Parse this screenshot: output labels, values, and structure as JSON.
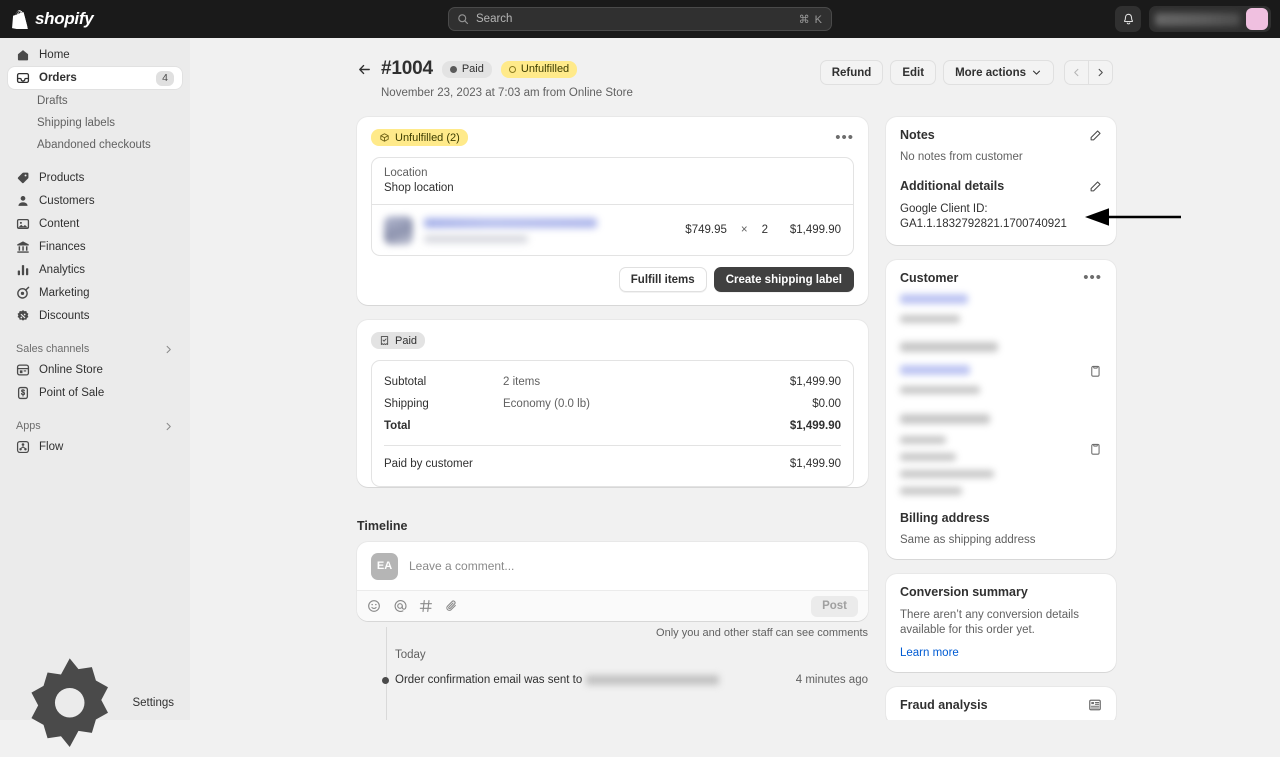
{
  "topbar": {
    "brand": "shopify",
    "brand_icon": "shopify-bag-icon",
    "search_placeholder": "Search",
    "search_shortcut": "⌘ K",
    "notifications_icon": "bell-icon",
    "store_avatar_initials": "",
    "store_name": ""
  },
  "sidebar": {
    "items": [
      {
        "label": "Home",
        "icon": "home-icon",
        "badge": ""
      },
      {
        "label": "Orders",
        "icon": "orders-inbox-icon",
        "badge": "4"
      }
    ],
    "sub_items": [
      {
        "label": "Drafts"
      },
      {
        "label": "Shipping labels"
      },
      {
        "label": "Abandoned checkouts"
      }
    ],
    "items2": [
      {
        "label": "Products",
        "icon": "tag-icon"
      },
      {
        "label": "Customers",
        "icon": "person-icon"
      },
      {
        "label": "Content",
        "icon": "content-icon"
      },
      {
        "label": "Finances",
        "icon": "bank-icon"
      },
      {
        "label": "Analytics",
        "icon": "bar-chart-icon"
      },
      {
        "label": "Marketing",
        "icon": "megaphone-target-icon"
      },
      {
        "label": "Discounts",
        "icon": "discount-badge-icon"
      }
    ],
    "section_sales": "Sales channels",
    "sales_channels": [
      {
        "label": "Online Store",
        "icon": "storefront-icon"
      },
      {
        "label": "Point of Sale",
        "icon": "pos-icon"
      }
    ],
    "section_apps": "Apps",
    "apps": [
      {
        "label": "Flow",
        "icon": "flow-app-icon"
      }
    ],
    "settings": {
      "label": "Settings",
      "icon": "gear-icon"
    }
  },
  "order": {
    "back_icon": "back-arrow-icon",
    "number": "#1004",
    "payment_status": "Paid",
    "fulfillment_status": "Unfulfilled",
    "date_line": "November 23, 2023 at 7:03 am from Online Store",
    "actions": {
      "refund": "Refund",
      "edit": "Edit",
      "more": "More actions",
      "prev_icon": "chevron-left-icon",
      "next_icon": "chevron-right-icon"
    }
  },
  "fulfillment_card": {
    "badge": "Unfulfilled (2)",
    "badge_icon": "package-icon",
    "menu_icon": "ellipsis-icon",
    "location_label": "Location",
    "location_value": "Shop location",
    "line_item": {
      "product_title": "",
      "unit_price": "$749.95",
      "multiply": "×",
      "quantity": "2",
      "line_total": "$1,499.90"
    },
    "fulfill_button": "Fulfill items",
    "shipping_label_button": "Create shipping label"
  },
  "payment_card": {
    "badge": "Paid",
    "badge_icon": "receipt-check-icon",
    "rows": [
      {
        "label": "Subtotal",
        "detail": "2 items",
        "amount": "$1,499.90",
        "bold": false
      },
      {
        "label": "Shipping",
        "detail": "Economy (0.0 lb)",
        "amount": "$0.00",
        "bold": false
      },
      {
        "label": "Total",
        "detail": "",
        "amount": "$1,499.90",
        "bold": true
      }
    ],
    "paid_row": {
      "label": "Paid by customer",
      "amount": "$1,499.90"
    }
  },
  "timeline": {
    "title": "Timeline",
    "avatar_initials": "EA",
    "comment_placeholder": "Leave a comment...",
    "tools": [
      {
        "icon": "emoji-icon"
      },
      {
        "icon": "mention-at-icon"
      },
      {
        "icon": "hashtag-icon"
      },
      {
        "icon": "attachment-clip-icon"
      }
    ],
    "post_button": "Post",
    "privacy_hint": "Only you and other staff can see comments",
    "day_label": "Today",
    "events": [
      {
        "text": "Order confirmation email was sent to",
        "redacted_email": "",
        "time": "4 minutes ago"
      }
    ]
  },
  "notes_card": {
    "title": "Notes",
    "edit_icon": "pencil-icon",
    "body": "No notes from customer",
    "additional_title": "Additional details",
    "additional_edit_icon": "pencil-icon",
    "detail_label": "Google Client ID:",
    "detail_value": "GA1.1.1832792821.1700740921"
  },
  "customer_card": {
    "title": "Customer",
    "menu_icon": "ellipsis-icon",
    "copy_icon": "copy-icon",
    "billing_title": "Billing address",
    "billing_value": "Same as shipping address"
  },
  "conversion_card": {
    "title": "Conversion summary",
    "body": "There aren’t any conversion details available for this order yet.",
    "link": "Learn more"
  },
  "fraud_card": {
    "title": "Fraud analysis",
    "icon": "report-icon"
  },
  "annotation": {
    "arrow_icon": "left-arrow-annotation"
  },
  "colors": {
    "topbar_bg": "#1a1a1a",
    "sidebar_bg": "#ebebeb",
    "page_bg": "#f1f1f1",
    "accent_link": "#005bd3",
    "warning_badge": "#ffea8a",
    "primary_button": "#404040"
  }
}
